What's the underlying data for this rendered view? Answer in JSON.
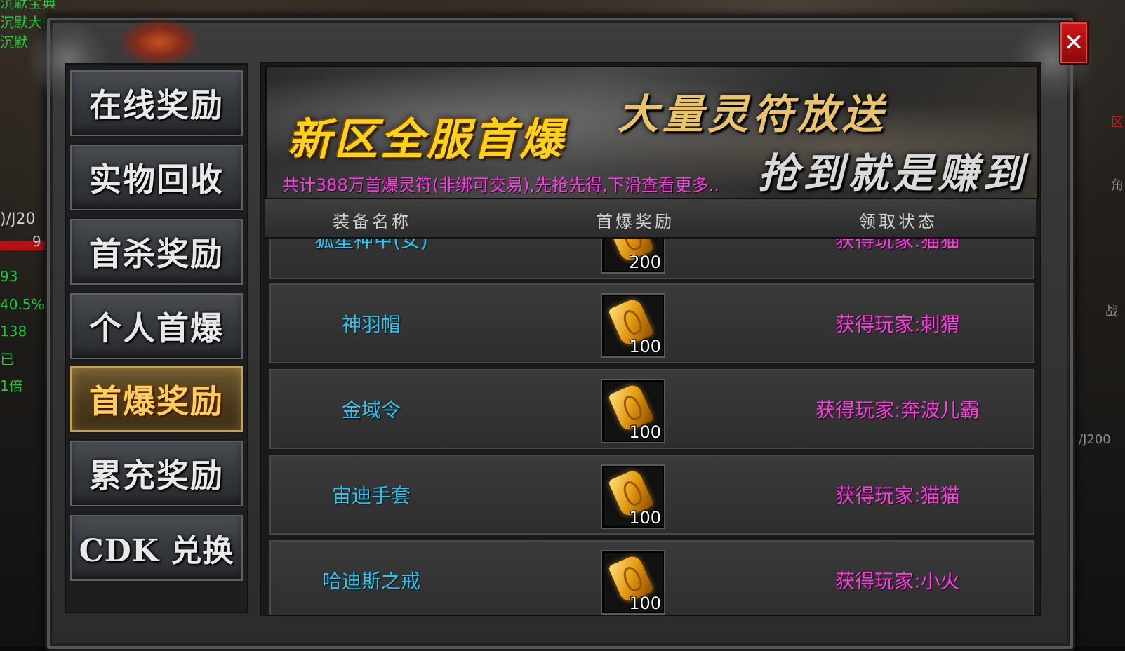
{
  "hud_left": {
    "lines": [
      "沉默宝典",
      "沉默大师",
      "沉默",
      ")/J20",
      "9",
      "93",
      "40.5%",
      "138",
      "已",
      "1倍"
    ]
  },
  "hud_right": {
    "lines": [
      "区",
      "角",
      "战",
      "/J200"
    ]
  },
  "close_button": {
    "label": "✕",
    "icon": "close-icon"
  },
  "sidebar": {
    "items": [
      {
        "label": "在线奖励",
        "active": false
      },
      {
        "label": "实物回收",
        "active": false
      },
      {
        "label": "首杀奖励",
        "active": false
      },
      {
        "label": "个人首爆",
        "active": false
      },
      {
        "label": "首爆奖励",
        "active": true
      },
      {
        "label": "累充奖励",
        "active": false
      },
      {
        "label": "CDK 兑换",
        "active": false
      }
    ]
  },
  "banner": {
    "title_left": "新区全服首爆",
    "title_right_top": "大量灵符放送",
    "title_right_bottom": "抢到就是赚到",
    "subtitle": "共计388万首爆灵符(非绑可交易),先抢先得,下滑查看更多.."
  },
  "table": {
    "headers": [
      "装备名称",
      "首爆奖励",
      "领取状态"
    ],
    "rows": [
      {
        "name": "狐星神甲(女)",
        "reward_icon": "talisman-icon",
        "reward_qty": "200",
        "status": "获得玩家:猫猫"
      },
      {
        "name": "神羽帽",
        "reward_icon": "talisman-icon",
        "reward_qty": "100",
        "status": "获得玩家:刺猬"
      },
      {
        "name": "金域令",
        "reward_icon": "talisman-icon",
        "reward_qty": "100",
        "status": "获得玩家:奔波儿霸"
      },
      {
        "name": "宙迪手套",
        "reward_icon": "talisman-icon",
        "reward_qty": "100",
        "status": "获得玩家:猫猫"
      },
      {
        "name": "哈迪斯之戒",
        "reward_icon": "talisman-icon",
        "reward_qty": "100",
        "status": "获得玩家:小火"
      }
    ]
  },
  "colors": {
    "item_name": "#28c5f0",
    "status": "#ff39e3",
    "active_tab_text": "#ffcf5a",
    "banner_title": "#ffd21a",
    "close_button": "#d21818"
  }
}
